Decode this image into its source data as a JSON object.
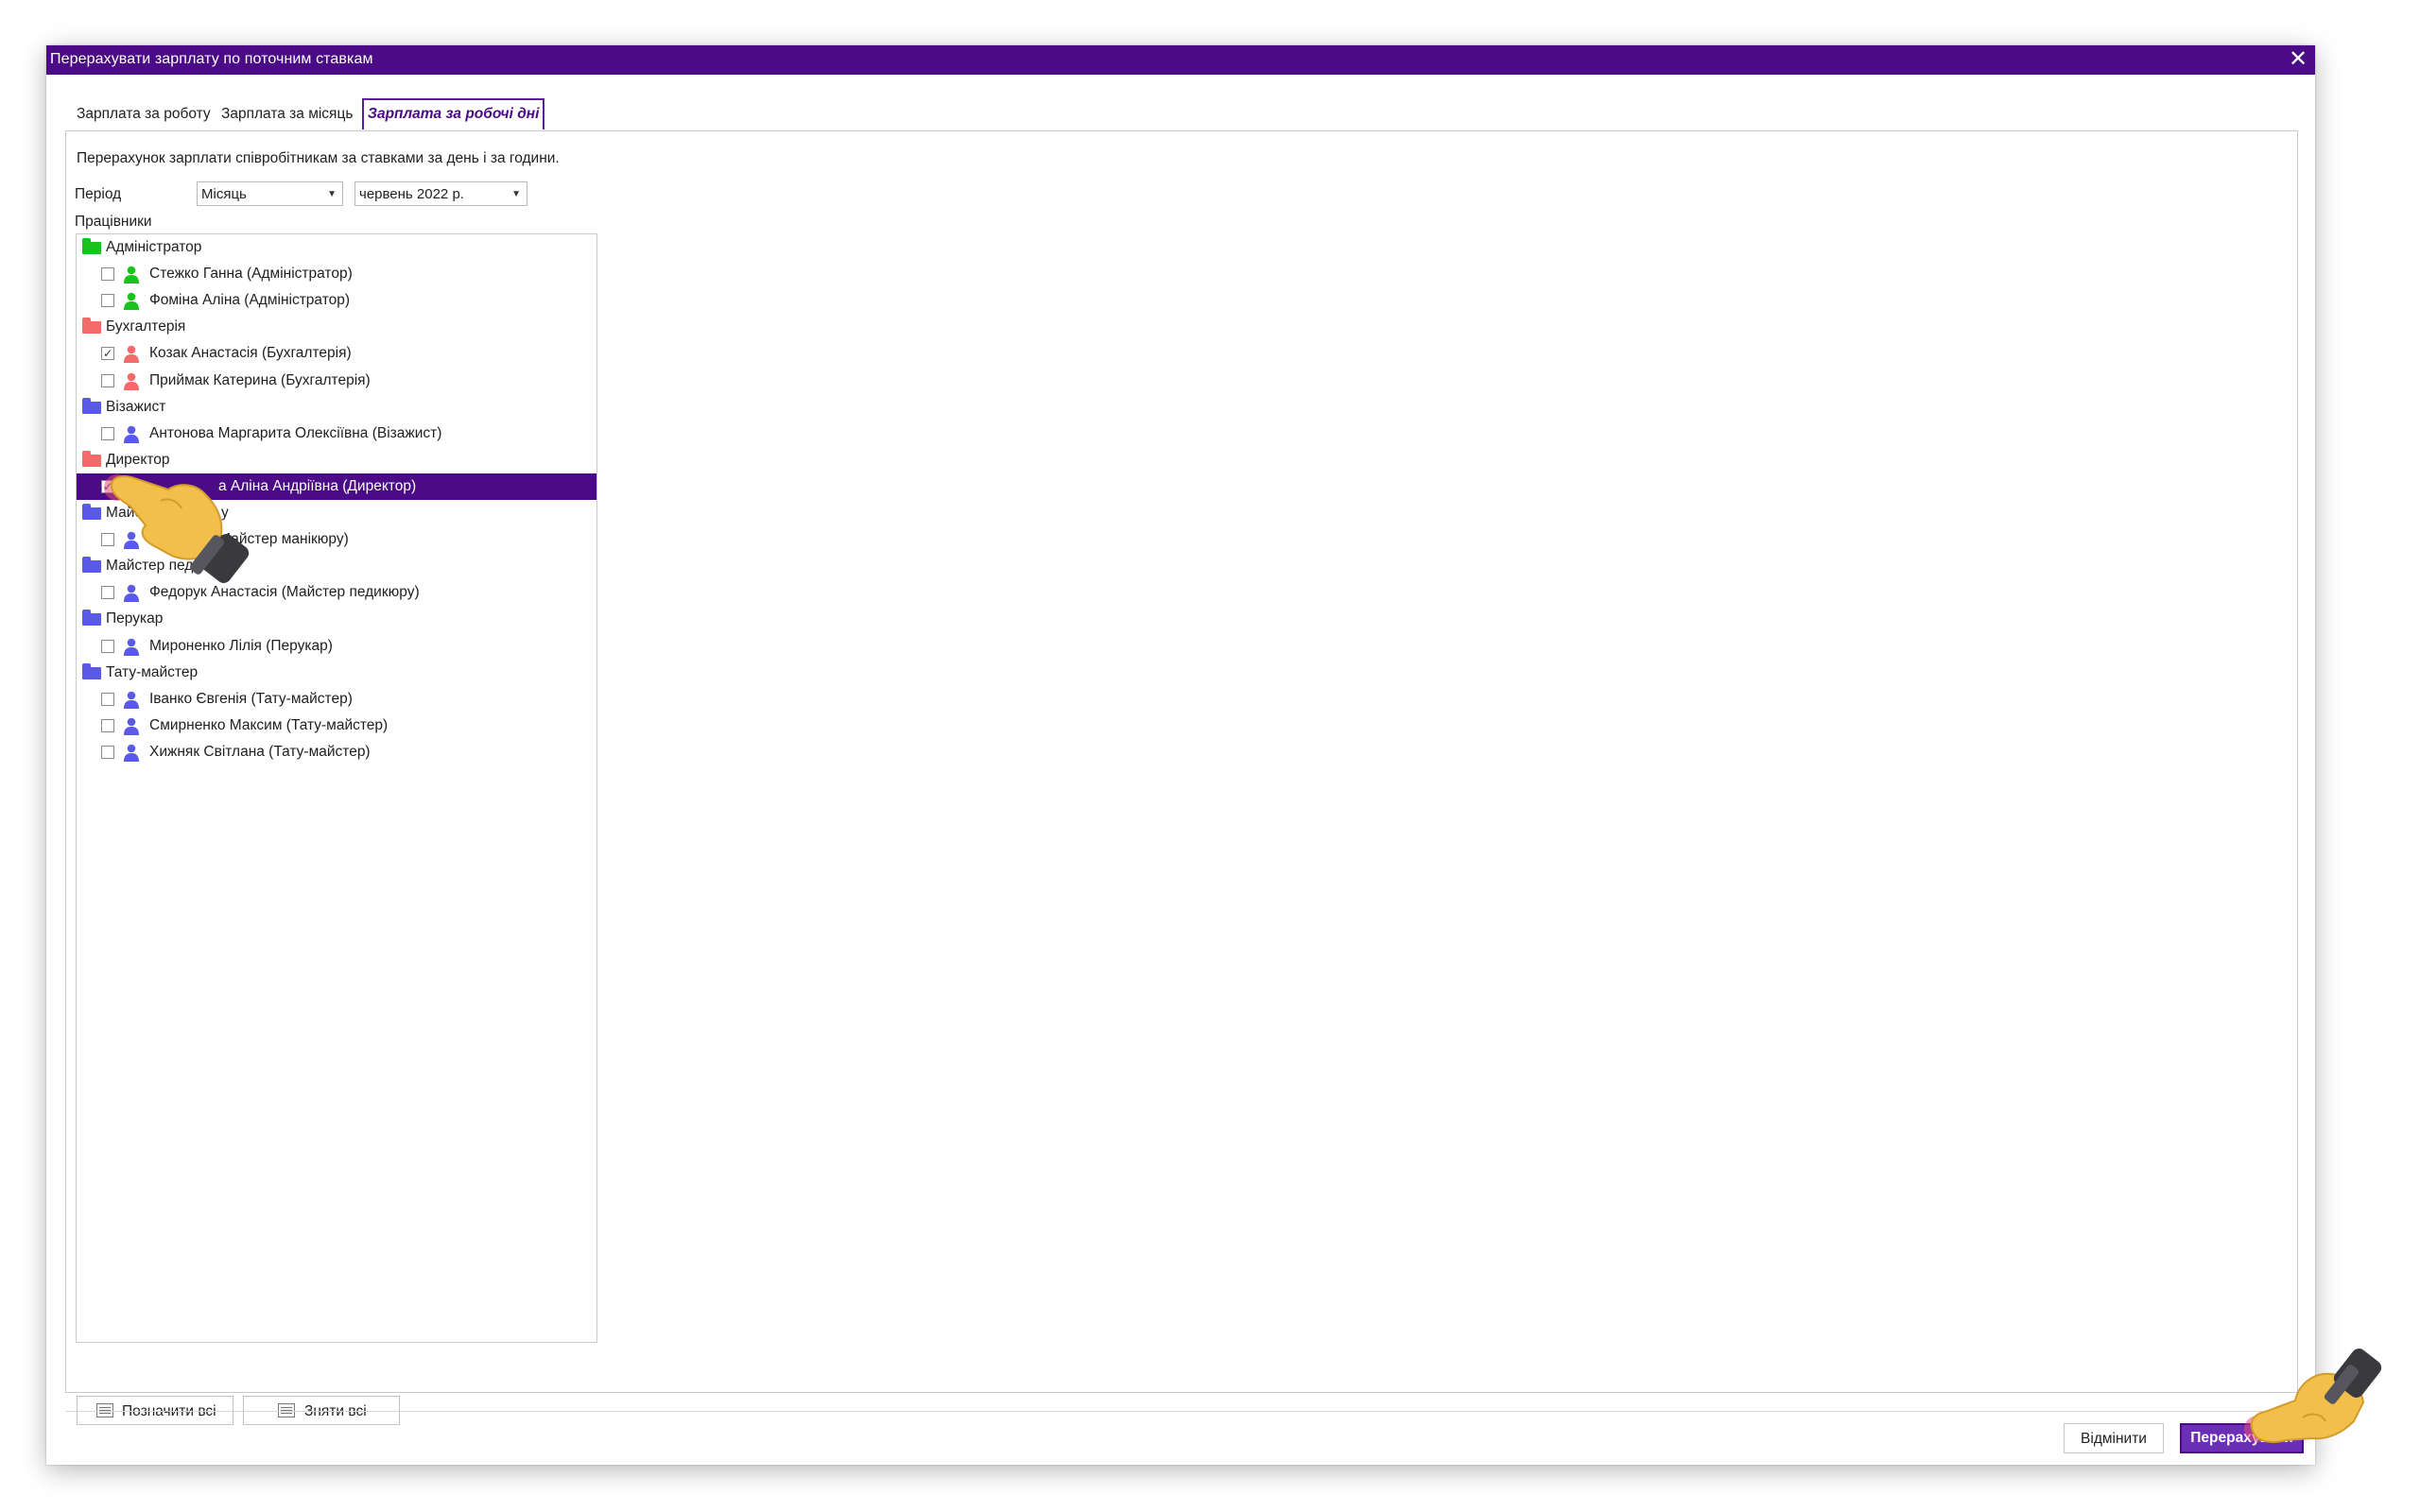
{
  "window": {
    "title": "Перерахувати зарплату по поточним ставкам",
    "close_glyph": "✕"
  },
  "tabs": [
    {
      "label": "Зарплата за роботу",
      "active": false
    },
    {
      "label": "Зарплата за місяць",
      "active": false
    },
    {
      "label": "Зарплата за робочі дні",
      "active": true
    }
  ],
  "panel": {
    "description": "Перерахунок зарплати співробітникам за ставками за день і за години.",
    "period_label": "Період",
    "period_type": "Місяць",
    "period_value": "червень  2022 р.",
    "employees_label": "Працівники"
  },
  "colors": {
    "accent": "#4b0a86",
    "admin": "#1bc21b",
    "accounting": "#f26a6a",
    "default_group": "#5a5ae6"
  },
  "groups": [
    {
      "label": "Адміністратор",
      "color": "#1bc21b",
      "icon": "folder-icon",
      "employees": [
        {
          "name": "Стежко Ганна (Адміністратор)",
          "checked": false
        },
        {
          "name": "Фоміна Аліна (Адміністратор)",
          "checked": false
        }
      ]
    },
    {
      "label": "Бухгалтерія",
      "color": "#f26a6a",
      "icon": "folder-icon",
      "employees": [
        {
          "name": "Козак Анастасія (Бухгалтерія)",
          "checked": true
        },
        {
          "name": "Приймак Катерина (Бухгалтерія)",
          "checked": false
        }
      ]
    },
    {
      "label": "Візажист",
      "color": "#5a5ae6",
      "icon": "folder-icon",
      "employees": [
        {
          "name": "Антонова Маргарита Олексіївна (Візажист)",
          "checked": false
        }
      ]
    },
    {
      "label": "Директор",
      "color": "#f26a6a",
      "icon": "folder-icon",
      "employees": [
        {
          "name": "а Аліна Андріївна (Директор)",
          "checked": true,
          "selected": true
        }
      ]
    },
    {
      "label": "Майст",
      "color": "#5a5ae6",
      "icon": "folder-icon",
      "label_tail": "у",
      "employees": [
        {
          "name": "(Майстер манікюру)",
          "checked": false
        }
      ]
    },
    {
      "label": "Майстер педи",
      "color": "#5a5ae6",
      "icon": "folder-icon",
      "employees": [
        {
          "name": "Федорук Анастасія (Майстер педикюру)",
          "checked": false
        }
      ]
    },
    {
      "label": "Перукар",
      "color": "#5a5ae6",
      "icon": "folder-icon",
      "employees": [
        {
          "name": "Мироненко Лілія (Перукар)",
          "checked": false
        }
      ]
    },
    {
      "label": "Тату-майстер",
      "color": "#5a5ae6",
      "icon": "folder-icon",
      "employees": [
        {
          "name": "Іванко Євгенія (Тату-майстер)",
          "checked": false
        },
        {
          "name": "Смирненко Максим (Тату-майстер)",
          "checked": false
        },
        {
          "name": "Хижняк Світлана (Тату-майстер)",
          "checked": false
        }
      ]
    }
  ],
  "tree_buttons": {
    "select_all": "Позначити всі",
    "clear_all": "Зняти всі"
  },
  "footer": {
    "cancel": "Відмінити",
    "recalculate": "Перерахувати"
  }
}
